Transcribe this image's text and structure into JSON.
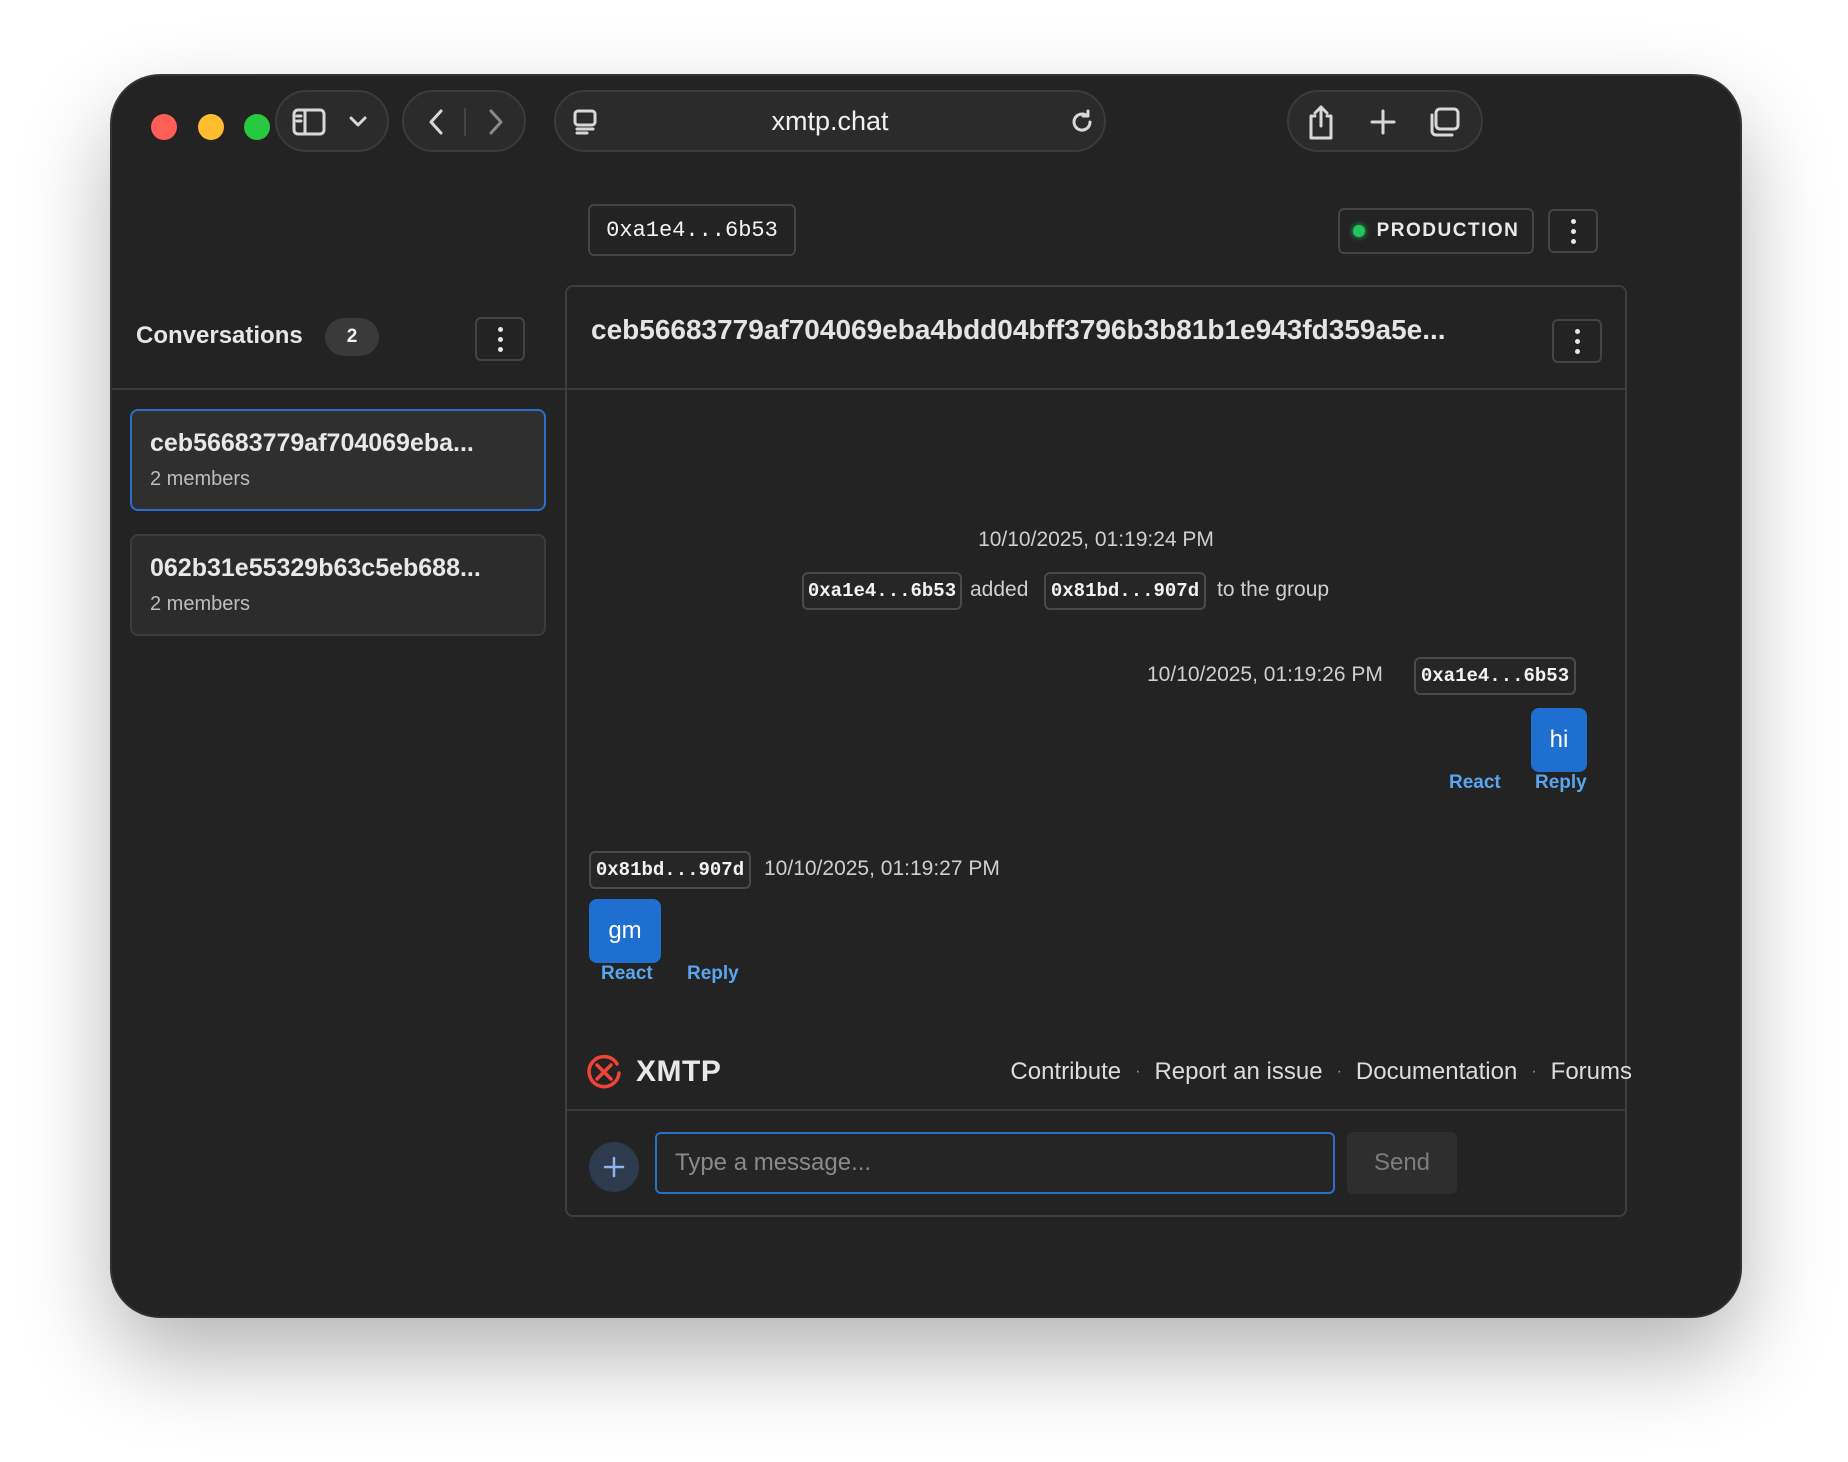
{
  "browser": {
    "url": "xmtp.chat",
    "icons": [
      "sidebar-icon",
      "chevron-down-icon",
      "back-icon",
      "forward-icon",
      "reader-icon",
      "reload-icon",
      "share-icon",
      "new-tab-icon",
      "tabs-overview-icon"
    ]
  },
  "header": {
    "account_address": "0xa1e4...6b53",
    "environment": "PRODUCTION",
    "status_color": "#22c55e"
  },
  "sidebar": {
    "title": "Conversations",
    "count": "2",
    "conversations": [
      {
        "title": "ceb56683779af704069eba...",
        "subtitle": "2 members",
        "active": true
      },
      {
        "title": "062b31e55329b63c5eb688...",
        "subtitle": "2 members",
        "active": false
      }
    ]
  },
  "chat": {
    "title": "ceb56683779af704069eba4bdd04bff3796b3b81b1e943fd359a5e...",
    "system_event": {
      "timestamp": "10/10/2025, 01:19:24 PM",
      "actor": "0xa1e4...6b53",
      "verb": "added",
      "target": "0x81bd...907d",
      "suffix": "to the group"
    },
    "messages": [
      {
        "sender": "0xa1e4...6b53",
        "timestamp": "10/10/2025, 01:19:26 PM",
        "text": "hi",
        "react_label": "React",
        "reply_label": "Reply"
      },
      {
        "sender": "0x81bd...907d",
        "timestamp": "10/10/2025, 01:19:27 PM",
        "text": "gm",
        "react_label": "React",
        "reply_label": "Reply"
      }
    ],
    "composer": {
      "placeholder": "Type a message...",
      "send_label": "Send"
    },
    "accent_color": "#1e6fd0"
  },
  "footer": {
    "brand": "XMTP",
    "links": [
      "Contribute",
      "Report an issue",
      "Documentation",
      "Forums"
    ],
    "separator": "·"
  }
}
